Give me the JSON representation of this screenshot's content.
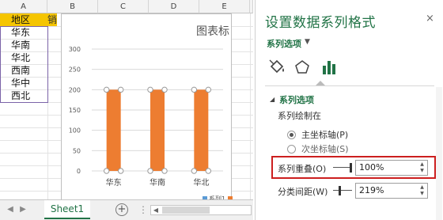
{
  "sheet": {
    "columns": [
      "A",
      "B",
      "C",
      "D",
      "E"
    ],
    "header_cell": "地区",
    "header_cell_b_partial": "销",
    "regions": [
      "华东",
      "华南",
      "华北",
      "西南",
      "华中",
      "西北"
    ],
    "tab_name": "Sheet1",
    "add_sheet": "+"
  },
  "chart_data": {
    "type": "bar",
    "title": "图表标",
    "categories": [
      "华东",
      "华南",
      "华北"
    ],
    "series": [
      {
        "name": "系列1",
        "values": [
          200,
          200,
          200
        ]
      }
    ],
    "ylim": [
      0,
      300
    ],
    "yticks": [
      "0",
      "50",
      "100",
      "150",
      "200",
      "250",
      "300"
    ],
    "legend_position": "bottom",
    "colors": {
      "bar": "#ed7d31",
      "legend_swatch_1": "#5b9bd5",
      "legend_swatch_2": "#ed7d31"
    }
  },
  "pane": {
    "title": "设置数据系列格式",
    "close": "×",
    "subtitle": "系列选项",
    "subtitle_arrow": "▼",
    "icons": [
      "fill-bucket-icon",
      "pentagon-icon",
      "bar-chart-icon"
    ],
    "section_toggle": "◢",
    "section_title": "系列选项",
    "plot_on": "系列绘制在",
    "primary_axis": "主坐标轴(P)",
    "secondary_axis": "次坐标轴(S)",
    "overlap_label": "系列重叠(O)",
    "overlap_value": "100%",
    "gap_label": "分类间距(W)",
    "gap_value": "219%"
  }
}
